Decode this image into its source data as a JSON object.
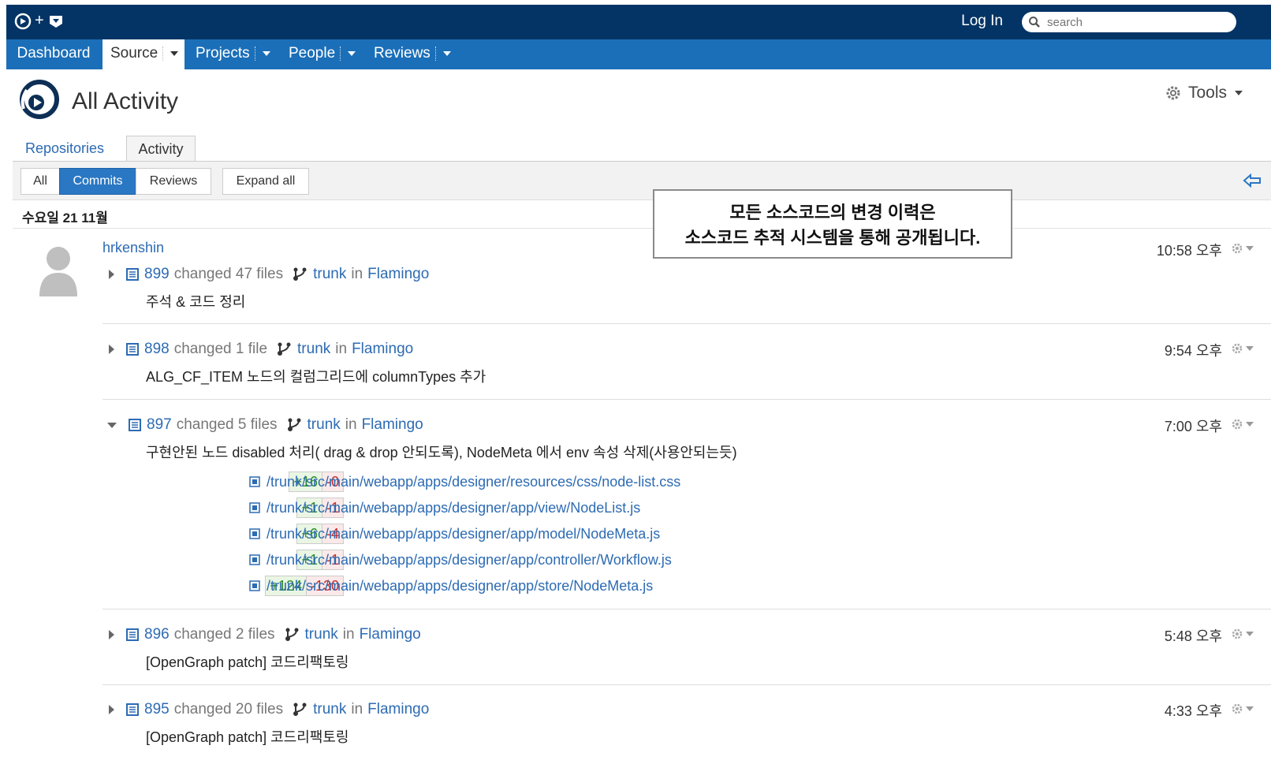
{
  "header": {
    "login": "Log In",
    "search_placeholder": "search"
  },
  "nav": {
    "dashboard": "Dashboard",
    "source": "Source",
    "projects": "Projects",
    "people": "People",
    "reviews": "Reviews"
  },
  "page": {
    "title": "All Activity",
    "tools": "Tools"
  },
  "tabs": {
    "repositories": "Repositories",
    "activity": "Activity"
  },
  "filters": {
    "all": "All",
    "commits": "Commits",
    "reviews": "Reviews",
    "expand": "Expand all"
  },
  "date_header": "수요일 21 11월",
  "callout": {
    "line1": "모든 소스코드의 변경 이력은",
    "line2": "소스코드 추적 시스템을 통해 공개됩니다."
  },
  "author": "hrkenshin",
  "branch": "trunk",
  "in_word": "in",
  "project": "Flamingo",
  "commits": [
    {
      "rev": "899",
      "changed": "changed 47 files",
      "message": "주석 & 코드 정리",
      "time": "10:58 오후"
    },
    {
      "rev": "898",
      "changed": "changed 1 file",
      "message": "ALG_CF_ITEM 노드의 컬럼그리드에 columnTypes 추가",
      "time": "9:54 오후"
    },
    {
      "rev": "897",
      "changed": "changed 5 files",
      "message": "구현안된 노드 disabled 처리( drag & drop 안되도록), NodeMeta 에서 env 속성 삭제(사용안되는듯)",
      "time": "7:00 오후",
      "files": [
        {
          "add": "+16",
          "del": "-0",
          "path": "/trunk/src/main/webapp/apps/designer/resources/css/node-list.css"
        },
        {
          "add": "+1",
          "del": "-1",
          "path": "/trunk/src/main/webapp/apps/designer/app/view/NodeList.js"
        },
        {
          "add": "+6",
          "del": "-4",
          "path": "/trunk/src/main/webapp/apps/designer/app/model/NodeMeta.js"
        },
        {
          "add": "+1",
          "del": "-1",
          "path": "/trunk/src/main/webapp/apps/designer/app/controller/Workflow.js"
        },
        {
          "add": "+124",
          "del": "-130",
          "path": "/trunk/src/main/webapp/apps/designer/app/store/NodeMeta.js"
        }
      ]
    },
    {
      "rev": "896",
      "changed": "changed 2 files",
      "message": "[OpenGraph patch] 코드리팩토링",
      "time": "5:48 오후"
    },
    {
      "rev": "895",
      "changed": "changed 20 files",
      "message": "[OpenGraph patch] 코드리팩토링",
      "time": "4:33 오후"
    }
  ],
  "colors": {
    "topbar": "#043465",
    "nav": "#1b6fb8",
    "link": "#2d6bb3",
    "add": "#2a8a2a",
    "del": "#c62d2d"
  }
}
